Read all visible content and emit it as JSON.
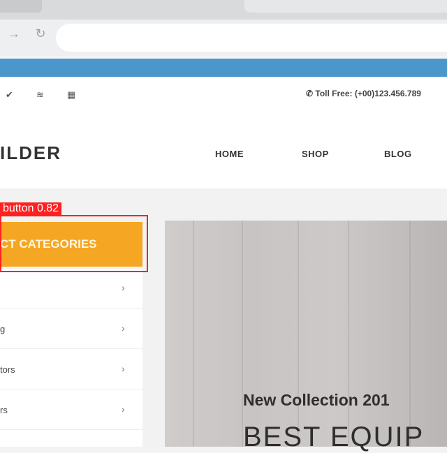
{
  "topbar": {
    "social_icons": [
      "twitter-icon",
      "rss-icon",
      "email-icon"
    ],
    "toll_free": "Toll Free: (+00)123.456.789"
  },
  "header": {
    "logo_text": "ILDER",
    "menu": [
      "HOME",
      "SHOP",
      "BLOG"
    ]
  },
  "sidebar": {
    "categories_button": "CT CATEGORIES",
    "items": [
      {
        "label": ""
      },
      {
        "label": "g"
      },
      {
        "label": "tors"
      },
      {
        "label": "rs"
      }
    ]
  },
  "detection": {
    "label": "button",
    "score": "0.82"
  },
  "hero": {
    "subtitle": "New Collection 201",
    "title": "BEST EQUIP"
  },
  "colors": {
    "accent": "#f5a623",
    "blue_strip": "#4b97cc",
    "detection": "#ff2020"
  }
}
